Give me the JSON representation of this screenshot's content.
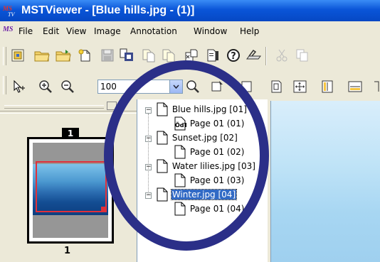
{
  "window": {
    "title": "MSTViewer - [Blue hills.jpg - (1)]"
  },
  "menu": {
    "items": [
      "File",
      "Edit",
      "View",
      "Image",
      "Annotation",
      "Window",
      "Help"
    ]
  },
  "toolbar": {
    "row1_icons": [
      "scan-icon",
      "open-folder-icon",
      "open-folder-arrow-icon",
      "new-page-icon",
      "save-icon",
      "print-preview-icon",
      "copy-page-icon",
      "paste-page-icon",
      "insert-page-icon",
      "properties-icon",
      "help-icon",
      "scanner-icon",
      "cut-icon",
      "copy-icon"
    ],
    "row2_icons": [
      "pointer-icon",
      "zoom-in-icon",
      "zoom-out-icon"
    ],
    "row2_right_icons": [
      "magnifier-icon",
      "select-area-icon",
      "fit-page-icon",
      "fit-width-left-icon",
      "fit-both-icon",
      "fit-height-icon",
      "fit-width-icon"
    ],
    "zoom_value": "100"
  },
  "thumbnails": {
    "page_badge": "1",
    "page_label": "1"
  },
  "tree": {
    "items": [
      {
        "label": "Blue hills.jpg [01]",
        "selected": false
      },
      {
        "label": "Page 01 (01)",
        "selected": false
      },
      {
        "label": "Sunset.jpg [02]",
        "selected": false
      },
      {
        "label": "Page 01 (02)",
        "selected": false
      },
      {
        "label": "Water lilies.jpg [03]",
        "selected": false
      },
      {
        "label": "Page 01 (03)",
        "selected": false
      },
      {
        "label": "Winter.jpg [04]",
        "selected": true
      },
      {
        "label": "Page 01 (04)",
        "selected": false
      }
    ]
  },
  "colors": {
    "titlebar": "#0a55d8",
    "ring": "#2b2f88",
    "selection": "#316ac5",
    "thumb_frame": "#e0303a"
  }
}
